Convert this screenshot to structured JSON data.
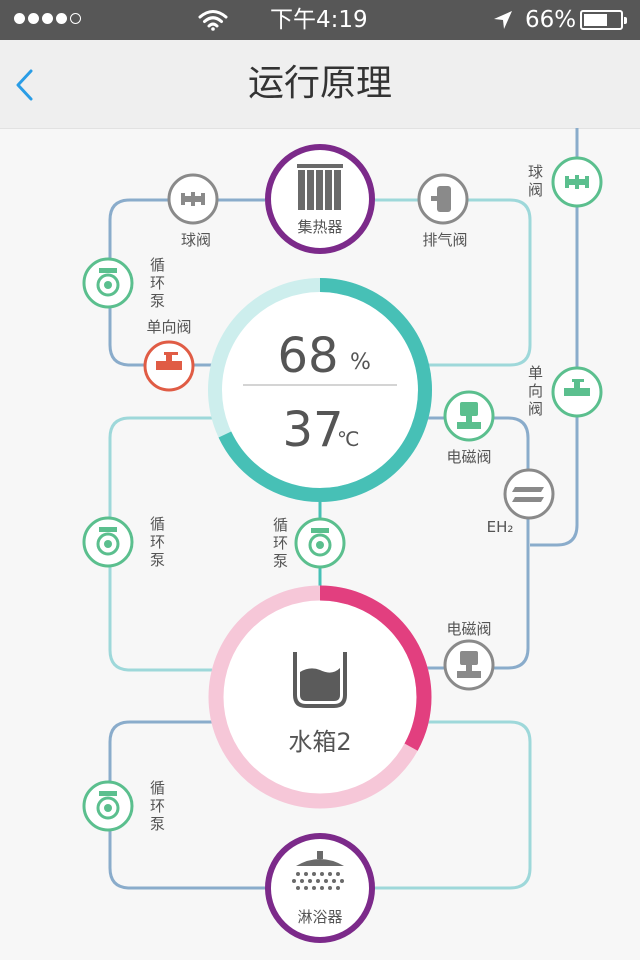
{
  "status_bar": {
    "carrier_dots_filled": 4,
    "carrier_dots_total": 5,
    "time": "下午4:19",
    "battery_percent": "66%",
    "battery_level": 0.66
  },
  "nav": {
    "title": "运行原理",
    "back_icon": "chevron-left-icon"
  },
  "collector": {
    "label": "集热器",
    "icon": "solar-panel-icon"
  },
  "gauge": {
    "percent_value": "68",
    "percent_unit": "%",
    "temp_value": "37",
    "temp_unit": "℃",
    "level": 0.68
  },
  "tank": {
    "label": "水箱2",
    "icon": "tank-icon",
    "level": 0.33
  },
  "shower": {
    "label": "淋浴器",
    "icon": "shower-icon"
  },
  "components": {
    "ball_valve_top": "球阀",
    "exhaust_valve": "排气阀",
    "pump_upper_left": "循环泵",
    "check_valve_left": "单向阀",
    "ball_valve_right": "球阀",
    "check_valve_right": "单向阀",
    "solenoid_valve_upper": "电磁阀",
    "heater": "EH₂",
    "pump_mid_left": "循环泵",
    "pump_center": "循环泵",
    "solenoid_valve_lower": "电磁阀",
    "pump_lower_left": "循环泵"
  },
  "colors": {
    "teal": "#47c0b6",
    "teal_light": "#cdeeed",
    "pink": "#e23f7f",
    "pink_light": "#f6c7d8",
    "purple": "#7c2a8a",
    "green": "#5bbf8e",
    "gray_valve": "#8a8a8a",
    "red_valve": "#e05c45",
    "blue_pipe": "#8aaccb",
    "teal_pipe": "#9ed8da"
  }
}
